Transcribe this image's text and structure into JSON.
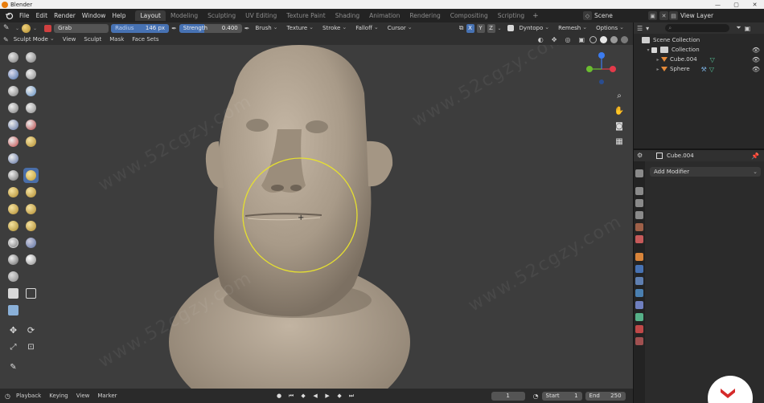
{
  "titlebar": {
    "title": "Blender",
    "buttons": [
      "—",
      "▢",
      "✕"
    ]
  },
  "menus": [
    "File",
    "Edit",
    "Render",
    "Window",
    "Help"
  ],
  "workspaces": [
    {
      "label": "Layout",
      "active": true
    },
    {
      "label": "Modeling",
      "active": false
    },
    {
      "label": "Sculpting",
      "active": false
    },
    {
      "label": "UV Editing",
      "active": false
    },
    {
      "label": "Texture Paint",
      "active": false
    },
    {
      "label": "Shading",
      "active": false
    },
    {
      "label": "Animation",
      "active": false
    },
    {
      "label": "Rendering",
      "active": false
    },
    {
      "label": "Compositing",
      "active": false
    },
    {
      "label": "Scripting",
      "active": false
    }
  ],
  "workspace_add": "+",
  "scene": {
    "label": "Scene"
  },
  "view_layer": {
    "label": "View Layer"
  },
  "tool_header": {
    "brush_name": "Grab",
    "radius_label": "Radius",
    "radius_value": "146 px",
    "strength_label": "Strength",
    "strength_value": "0.400",
    "strength_fraction": 0.4,
    "menus": [
      "Brush",
      "Texture",
      "Stroke",
      "Falloff",
      "Cursor"
    ],
    "axes": [
      "X",
      "Y",
      "Z"
    ],
    "dyntopo_label": "Dyntopo",
    "remesh_label": "Remesh",
    "options_label": "Options"
  },
  "mode_header": {
    "mode": "Sculpt Mode",
    "menus": [
      "View",
      "Sculpt",
      "Mask",
      "Face Sets"
    ]
  },
  "outliner": {
    "rows": [
      {
        "label": "Scene Collection",
        "icon": "collection-icon",
        "indent": 0
      },
      {
        "label": "Collection",
        "icon": "collection-icon",
        "indent": 1
      },
      {
        "label": "Cube.004",
        "icon": "mesh-icon",
        "indent": 2
      },
      {
        "label": "Sphere",
        "icon": "mesh-icon",
        "indent": 2
      }
    ]
  },
  "properties": {
    "object_name": "Cube.004",
    "add_modifier": "Add Modifier"
  },
  "timeline": {
    "menus": [
      "Playback",
      "Keying",
      "View",
      "Marker"
    ],
    "current_frame": "1",
    "start_label": "Start",
    "start_value": "1",
    "end_label": "End",
    "end_value": "250"
  },
  "watermark": "www.52cgzy.com",
  "colors": {
    "accent": "#4772b3",
    "viewport_bg": "#3d3d3d",
    "brush_circle": "#e6e030",
    "axis_x": "#e33a4a",
    "axis_y": "#6bbd2f",
    "axis_z": "#3c7cf0"
  }
}
